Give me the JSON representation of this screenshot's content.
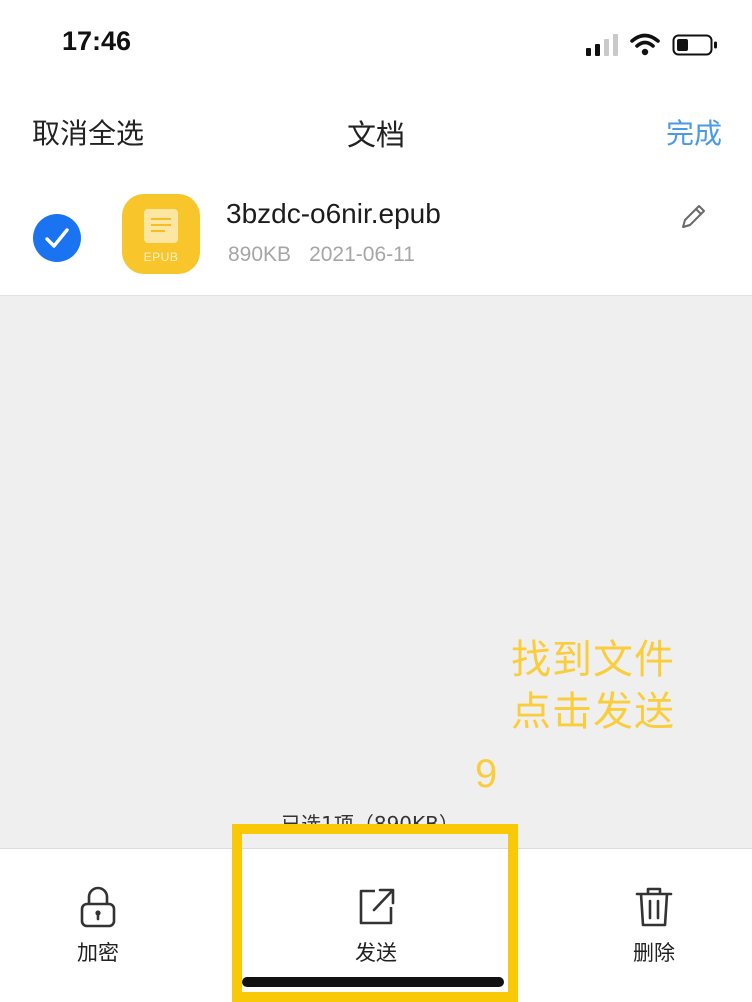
{
  "status_bar": {
    "time": "17:46"
  },
  "nav": {
    "cancel_label": "取消全选",
    "title": "文档",
    "done_label": "完成"
  },
  "file": {
    "name": "3bzdc-o6nir.epub",
    "size": "890KB",
    "date": "2021-06-11",
    "icon_label": "EPUB",
    "selected": true
  },
  "annotation": {
    "line1": "找到文件",
    "line2": "点击发送",
    "step": "9"
  },
  "selection_summary": "已选1项（890KB）",
  "toolbar": {
    "encrypt_label": "加密",
    "send_label": "发送",
    "delete_label": "删除"
  },
  "colors": {
    "accent_blue": "#4a9be6",
    "check_blue": "#1a74f2",
    "epub_yellow": "#f8c52b",
    "annotation_yellow": "#f9cd3c",
    "highlight_yellow": "#f9c807"
  }
}
